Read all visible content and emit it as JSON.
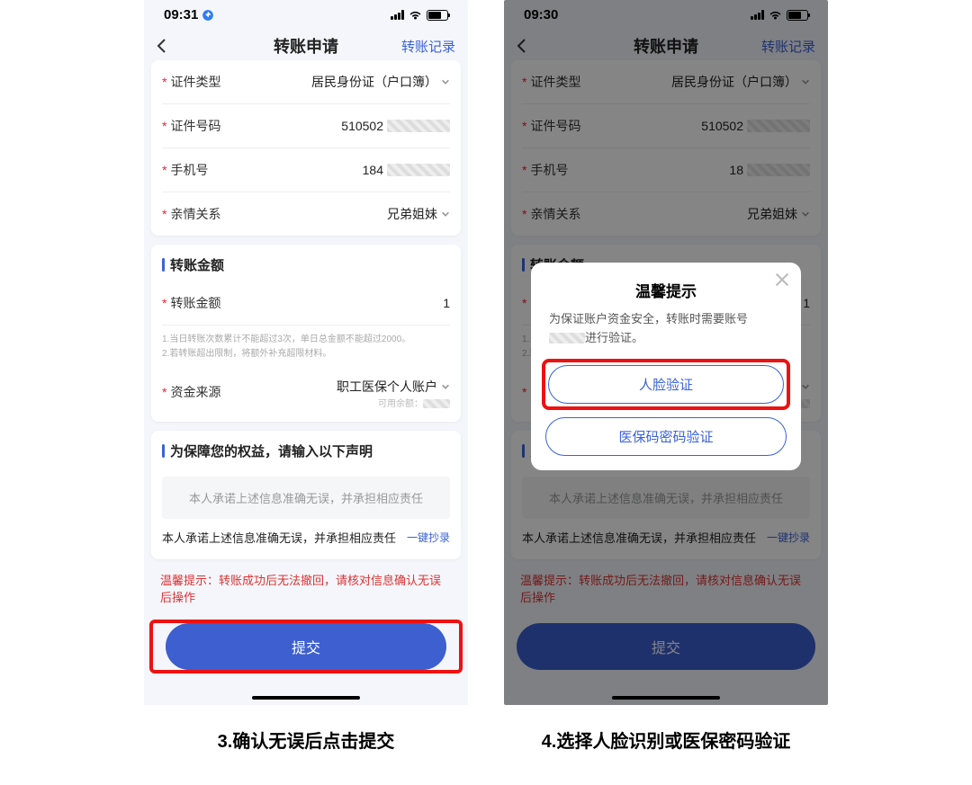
{
  "status": {
    "time1": "09:31",
    "time2": "09:30"
  },
  "header": {
    "title": "转账申请",
    "records": "转账记录"
  },
  "fields": {
    "certType_lbl": "证件类型",
    "certType_val": "居民身份证（户口簿）",
    "certNo_lbl": "证件号码",
    "certNo_val": "510502",
    "phone_lbl": "手机号",
    "phone_val1": "184",
    "phone_val2": "18",
    "rel_lbl": "亲情关系",
    "rel_val": "兄弟姐妹"
  },
  "amount": {
    "title": "转账金额",
    "lbl": "转账金额",
    "val": "1",
    "tip1": "1.当日转账次数累计不能超过3次，单日总金额不能超过2000。",
    "tip2": "2.若转账超出限制，将额外补充超限材料。",
    "src_lbl": "资金来源",
    "src_val": "职工医保个人账户",
    "avail_lbl": "可用余额："
  },
  "decl": {
    "title": "为保障您的权益，请输入以下声明",
    "box": "本人承诺上述信息准确无误，并承担相应责任",
    "text": "本人承诺上述信息准确无误，并承担相应责任",
    "copy": "一键抄录"
  },
  "warn": "温馨提示：转账成功后无法撤回，请核对信息确认无误后操作",
  "submit": "提交",
  "modal": {
    "title": "温馨提示",
    "text1": "为保证账户资金安全，转账时需要账号",
    "text2": "进行验证。",
    "btn1": "人脸验证",
    "btn2": "医保码密码验证"
  },
  "captions": {
    "c1": "3.确认无误后点击提交",
    "c2": "4.选择人脸识别或医保密码验证"
  }
}
